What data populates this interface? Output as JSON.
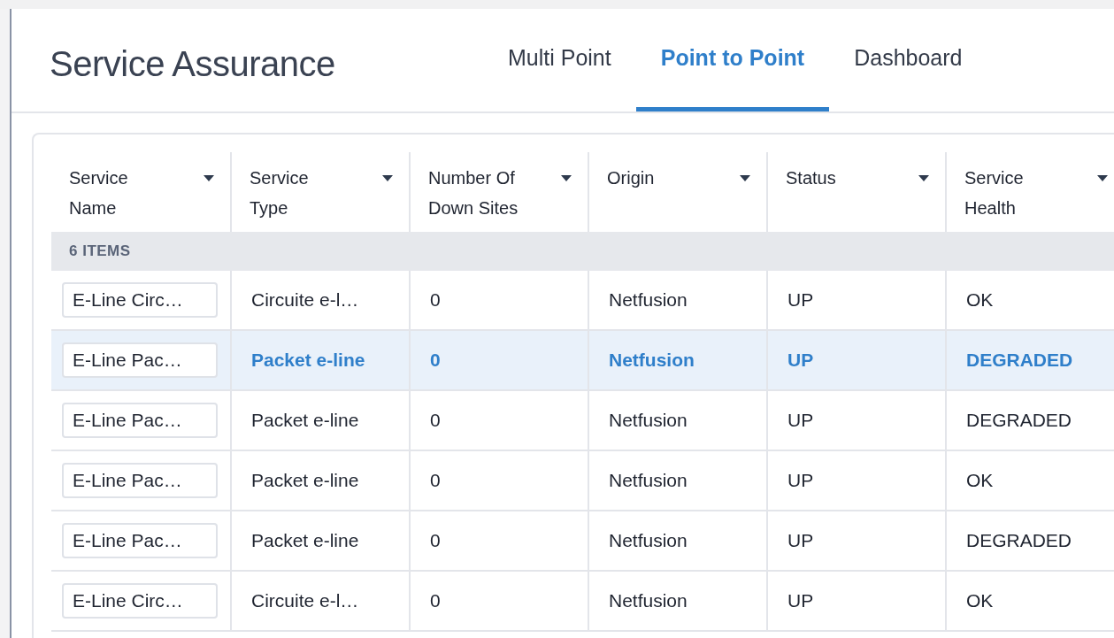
{
  "header": {
    "title": "Service Assurance"
  },
  "tabs": [
    {
      "label": "Multi Point",
      "selected": false
    },
    {
      "label": "Point to Point",
      "selected": true
    },
    {
      "label": "Dashboard",
      "selected": false
    }
  ],
  "table": {
    "columns": [
      "Service Name",
      "Service Type",
      "Number Of Down Sites",
      "Origin",
      "Status",
      "Service Health"
    ],
    "group_label": "6 ITEMS",
    "rows": [
      {
        "selected": false,
        "cells": [
          "E-Line Circ…",
          "Circuite e-l…",
          "0",
          "Netfusion",
          "UP",
          "OK"
        ]
      },
      {
        "selected": true,
        "cells": [
          "E-Line Pac…",
          "Packet e-line",
          "0",
          "Netfusion",
          "UP",
          "DEGRADED"
        ]
      },
      {
        "selected": false,
        "cells": [
          "E-Line Pac…",
          "Packet e-line",
          "0",
          "Netfusion",
          "UP",
          "DEGRADED"
        ]
      },
      {
        "selected": false,
        "cells": [
          "E-Line Pac…",
          "Packet e-line",
          "0",
          "Netfusion",
          "UP",
          "OK"
        ]
      },
      {
        "selected": false,
        "cells": [
          "E-Line Pac…",
          "Packet e-line",
          "0",
          "Netfusion",
          "UP",
          "DEGRADED"
        ]
      },
      {
        "selected": false,
        "cells": [
          "E-Line Circ…",
          "Circuite e-l…",
          "0",
          "Netfusion",
          "UP",
          "OK"
        ]
      }
    ]
  }
}
